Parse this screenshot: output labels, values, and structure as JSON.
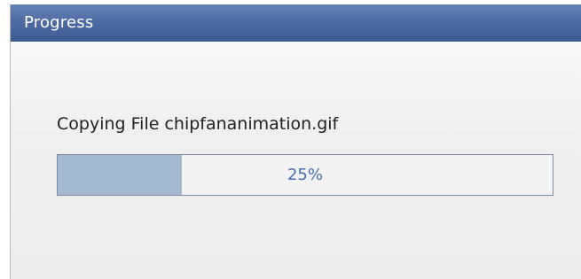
{
  "window": {
    "title": "Progress"
  },
  "progress": {
    "message": "Copying File chipfananimation.gif",
    "percent_label": "25%",
    "fraction": 0.25
  },
  "colors": {
    "titlebar": "#4f6da5",
    "progress_fill": "#a4b8cf",
    "progress_text": "#4b6ead"
  }
}
